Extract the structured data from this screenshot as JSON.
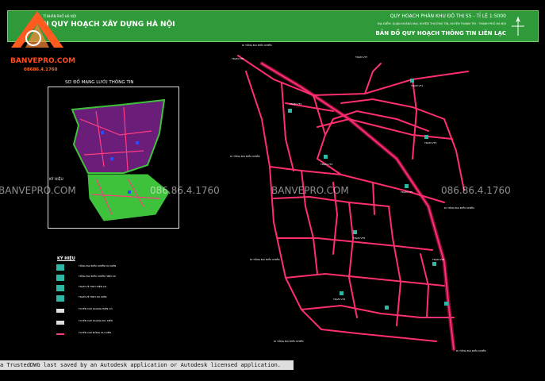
{
  "header": {
    "pre_org": "VIỆN QUY HOẠCH XÂY DỰNG HÀ NỘI",
    "org": "N QUY HOẠCH XÂY DỰNG HÀ NỘI",
    "pre": "TỈ NHÂN PHỐ HÀ NỘI",
    "title": "QUY HOẠCH PHÂN KHU ĐÔ THỊ S5 - TỈ LỆ 1:5000",
    "location": "ĐỊA ĐIỂM: QUẬN HOÀNG MAI, HUYỆN THƯỜNG TÍN, HUYỆN THANH TRÌ - THÀNH PHỐ HÀ NỘI",
    "map_name": "BẢN ĐỒ QUY HOẠCH THÔNG TIN LIÊN LẠC"
  },
  "brand": {
    "name": "BANVEPRO.COM",
    "phone": "08686.4.1760"
  },
  "watermarks": [
    {
      "text": "BANVEPRO.COM"
    },
    {
      "text": "086.86.4.1760"
    },
    {
      "text": "BANVEPRO.COM"
    },
    {
      "text": "086.86.4.1760"
    }
  ],
  "inset": {
    "title": "SƠ ĐỒ MẠNG LƯỚI THÔNG TIN",
    "legend_heading": "KÝ HIỆU"
  },
  "legend": {
    "heading": "KÝ HIỆU",
    "items": [
      {
        "label": "TỔNG ĐÀI ĐIỀU KHIỂN DỰ KIẾN",
        "swatch": "#2fb7a6"
      },
      {
        "label": "TỔNG ĐÀI ĐIỀU KHIỂN HIỆN CÓ",
        "swatch": "#2fb7a6"
      },
      {
        "label": "TRẠM VỆ TINH HIỆN CÓ",
        "swatch": "#2fb7a6"
      },
      {
        "label": "TRẠM VỆ TINH DỰ KIẾN",
        "swatch": "#2fb7a6"
      },
      {
        "label": "TUYẾN CÁP QUANG HIỆN CÓ",
        "swatch": "#e0e0e0"
      },
      {
        "label": "TUYẾN CÁP QUANG DỰ KIẾN",
        "swatch": "#e0e0e0"
      },
      {
        "label": "TUYẾN CÁP ĐỒNG DỰ KIẾN",
        "swatch": "#ff3d7f"
      }
    ]
  },
  "map_labels": [
    {
      "text": "DI TỔNG ĐÀI ĐIỀU KHIỂN"
    },
    {
      "text": "TRẠM VT0"
    },
    {
      "text": "TRẠM VT1"
    },
    {
      "text": "TRẠM VT2"
    },
    {
      "text": "TRẠM VT3"
    },
    {
      "text": "TRẠM VT4"
    },
    {
      "text": "TRẠM VT5"
    },
    {
      "text": "TRẠM VT6"
    },
    {
      "text": "TRẠM VT7"
    },
    {
      "text": "DI TỔNG ĐÀI ĐIỀU KHIỂN"
    },
    {
      "text": "DI TỔNG ĐÀI ĐIỀU KHIỂN"
    },
    {
      "text": "DI TỔNG ĐÀI ĐIỀU KHIỂN"
    },
    {
      "text": "DI TỔNG ĐÀI ĐIỀU KHIỂN"
    },
    {
      "text": "TRẠM VT8"
    },
    {
      "text": "TRẠM VT9"
    },
    {
      "text": "DI TỔNG ĐÀI ĐIỀU KHIỂN"
    }
  ],
  "status": "a TrustedDWG last saved by an Autodesk application or Autodesk licensed application.",
  "colors": {
    "header_bg": "#2f9a3a",
    "road": "#ff2f6d",
    "road_edge": "#b0124a",
    "inset_purple": "#6a1d79",
    "inset_green": "#3fc23b",
    "watermark": "#ffffff"
  }
}
